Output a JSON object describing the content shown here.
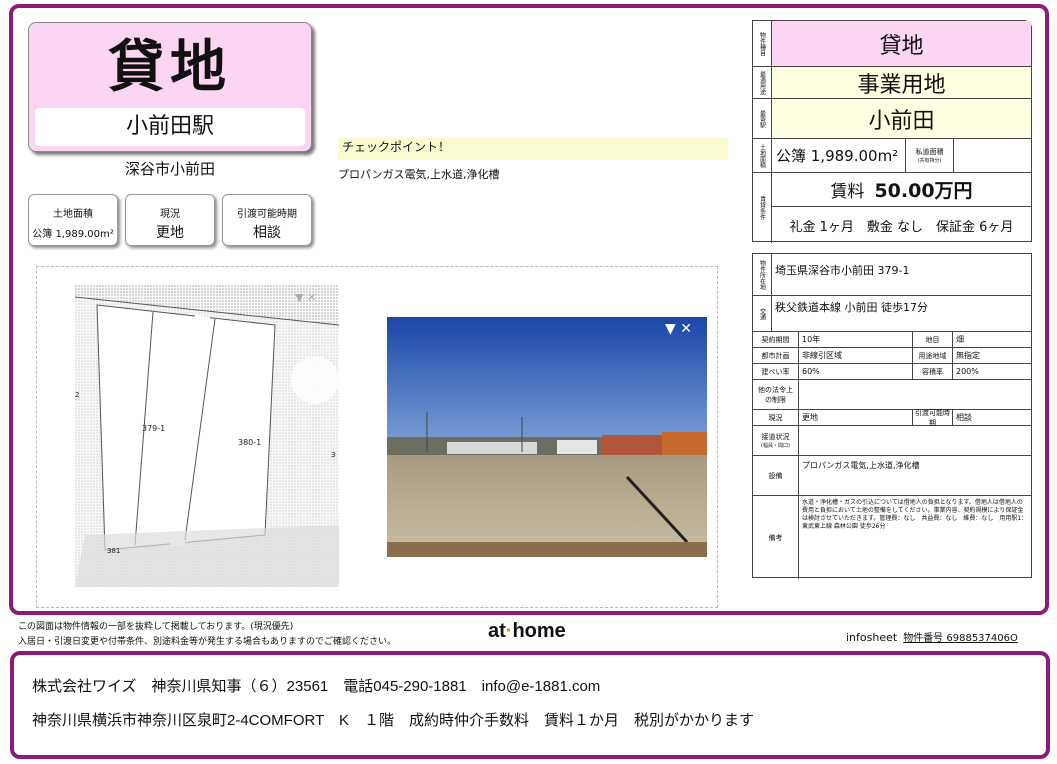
{
  "title": {
    "type": "貸地",
    "station": "小前田駅",
    "address_sub": "深谷市小前田"
  },
  "info_boxes": [
    {
      "label": "土地面積",
      "value": "公簿 1,989.00m²"
    },
    {
      "label": "現況",
      "value": "更地"
    },
    {
      "label": "引渡可能時期",
      "value": "相談"
    }
  ],
  "checkpoint": {
    "heading": "チェックポイント！",
    "text": "プロパンガス電気,上水道,浄化槽"
  },
  "map": {
    "lot1": "379-1",
    "lot2": "380-1",
    "lot3": "381",
    "lot4": "2",
    "lot5": "3"
  },
  "right_panel": {
    "type_label": "物件種目",
    "type_value": "貸地",
    "use_label": "最適用途",
    "use_value": "事業用地",
    "station_label": "最寄駅",
    "station_value": "小前田",
    "area_label": "土地面積",
    "area_value": "公簿 1,989.00m²",
    "private_road_label": "私道面積",
    "private_road_note": "(共有持分)",
    "cond_label": "賃貸条件",
    "rent_label": "賃料",
    "rent_value": "50.00万円",
    "deposit_line": "礼金 1ヶ月　敷金 なし　保証金 6ヶ月",
    "address_label": "物件所在地",
    "address_value": "埼玉県深谷市小前田 379-1",
    "transport_label": "交通",
    "transport_value": "秩父鉄道本線 小前田 徒歩17分",
    "term_label": "契約期間",
    "term_value": "10年",
    "chimoku_label": "地目",
    "chimoku_value": "畑",
    "city_label": "都市計画",
    "city_value": "非線引区域",
    "youto_label": "用途地域",
    "youto_value": "無指定",
    "kenpei_label": "建ぺい率",
    "kenpei_value": "60%",
    "yoseki_label": "容積率",
    "yoseki_value": "200%",
    "law_label": "他の法令上の制限",
    "genkyo_label": "現況",
    "genkyo_value": "更地",
    "hikiwatashi_label": "引渡可能時期",
    "hikiwatashi_value": "相談",
    "setsudo_label": "接道状況",
    "setsudo_note": "(幅員・間口)",
    "setsubi_label": "設備",
    "setsubi_value": "プロパンガス電気,上水道,浄化槽",
    "biko_label": "備考",
    "biko_value": "水道・浄化槽・ガスの引込については借地人の負担となります。借地人は借地人の費用と負担において土地の整備をしてください。事業内容、契約規模により保証金は検討させていただきます。管理費：なし　共益費：なし　維費：なし　用用駅1：東武東上線 森林公園 徒歩26分"
  },
  "notes": {
    "line1": "この図面は物件情報の一部を抜粋して掲載しております。(現況優先)",
    "line2": "入居日・引渡日変更や付帯条件、別途料金等が発生する場合もありますのでご確認ください。"
  },
  "brand": {
    "left": "at",
    "dot": "·",
    "right": "home"
  },
  "infosheet": {
    "label": "infosheet",
    "number": "物件番号 6988537406O"
  },
  "footer": {
    "line1": "株式会社ワイズ　神奈川県知事（６）23561　電話045-290-1881　info@e-1881.com",
    "line2": "神奈川県横浜市神奈川区泉町2-4COMFORT　K　１階　成約時仲介手数料　賃料１か月　税別がかかります"
  }
}
